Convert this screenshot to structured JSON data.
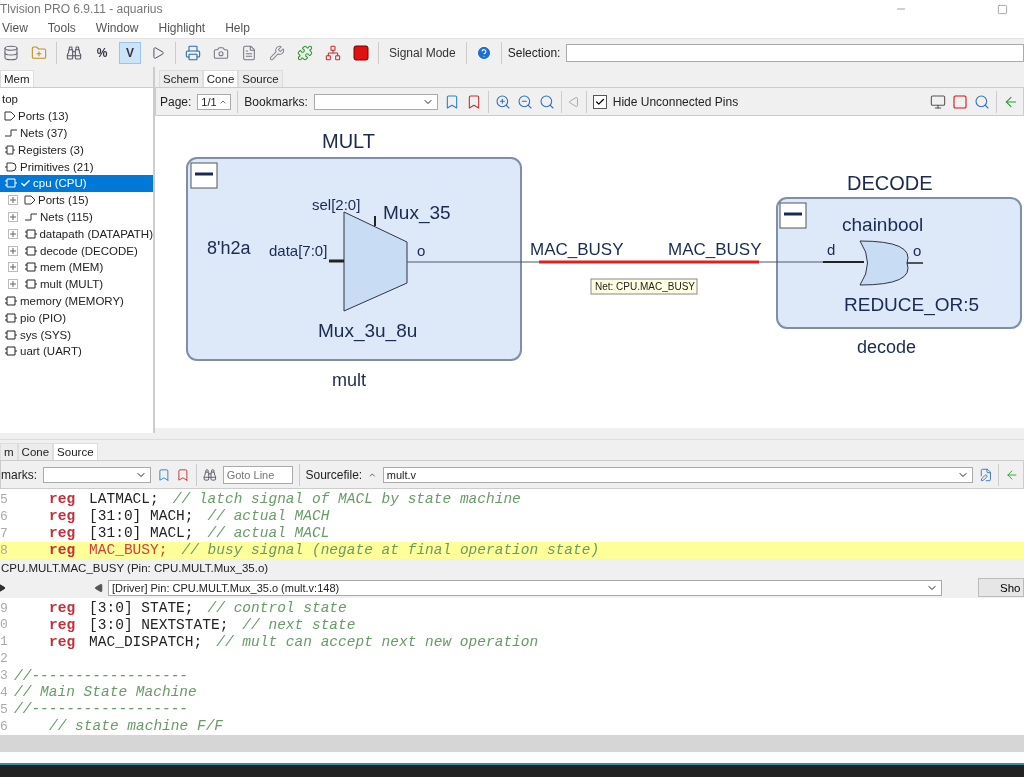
{
  "window": {
    "title": "Tlvision PRO 6.9.11 - aquarius"
  },
  "menu": [
    "View",
    "Tools",
    "Window",
    "Highlight",
    "Help"
  ],
  "toolbar": {
    "toggles": [
      {
        "label": "%",
        "selected": false
      },
      {
        "label": "V",
        "selected": true
      }
    ],
    "signal_mode": "Signal Mode",
    "selection_label": "Selection:"
  },
  "left_panel": {
    "tab": "Mem",
    "tree": {
      "label": "top",
      "selected": false,
      "children": [
        {
          "label": "Ports (13)",
          "kind": "port",
          "selected": false
        },
        {
          "label": "Nets (37)",
          "kind": "net",
          "selected": false
        },
        {
          "label": "Registers (3)",
          "kind": "register",
          "selected": false
        },
        {
          "label": "Primitives (21)",
          "kind": "primitive",
          "selected": false
        },
        {
          "label": "cpu (CPU)",
          "kind": "instance",
          "selected": true,
          "children": [
            {
              "label": "Ports (15)",
              "kind": "port",
              "selected": false,
              "expanded": false
            },
            {
              "label": "Nets (115)",
              "kind": "net",
              "selected": false,
              "expanded": false
            },
            {
              "label": "datapath (DATAPATH)",
              "kind": "instance",
              "selected": false,
              "expanded": false
            },
            {
              "label": "decode (DECODE)",
              "kind": "instance",
              "selected": false,
              "expanded": false
            },
            {
              "label": "mem (MEM)",
              "kind": "instance",
              "selected": false,
              "expanded": false
            },
            {
              "label": "mult (MULT)",
              "kind": "instance",
              "selected": false,
              "expanded": false
            }
          ]
        },
        {
          "label": "memory (MEMORY)",
          "kind": "instance",
          "selected": false
        },
        {
          "label": "pio (PIO)",
          "kind": "instance",
          "selected": false
        },
        {
          "label": "sys (SYS)",
          "kind": "instance",
          "selected": false
        },
        {
          "label": "uart (UART)",
          "kind": "instance",
          "selected": false
        }
      ]
    }
  },
  "schematic_tabs": [
    {
      "label": "Schem",
      "selected": false
    },
    {
      "label": "Cone",
      "selected": true
    },
    {
      "label": "Source",
      "selected": false
    }
  ],
  "schematic_toolbar": {
    "page_label": "Page:",
    "page": "1/1",
    "bookmarks_label": "Bookmarks:",
    "hide_pins": {
      "label": "Hide Unconnected Pins",
      "checked": true
    }
  },
  "schematic": {
    "mult_block": {
      "title": "MULT",
      "instance": "mult",
      "expanded": true,
      "constant": "8'h2a",
      "mux": {
        "name": "Mux_35",
        "cell": "Mux_3u_8u",
        "select_pin": "sel[2:0]",
        "data_pin": "data[7:0]",
        "output_pin": "o"
      }
    },
    "net": {
      "labels": [
        "MAC_BUSY",
        "MAC_BUSY"
      ],
      "highlighted": true,
      "tooltip": "Net: CPU.MAC_BUSY"
    },
    "decode_block": {
      "title": "DECODE",
      "instance": "decode",
      "expanded": true,
      "gate": {
        "name": "chainbool",
        "cell": "REDUCE_OR:5",
        "input_pin": "d",
        "output_pin": "o"
      }
    }
  },
  "source_tabs": [
    {
      "label": "m",
      "selected": false
    },
    {
      "label": "Cone",
      "selected": false
    },
    {
      "label": "Source",
      "selected": true
    }
  ],
  "source_toolbar": {
    "bookmarks_label": "marks:",
    "goto_placeholder": "Goto Line",
    "sourcefile_label": "Sourcefile:",
    "sourcefile": "mult.v"
  },
  "code_top": [
    {
      "number": "5",
      "indented": true,
      "keyword": "reg",
      "code": "LATMACL;",
      "comment": "// latch signal of MACL by state machine",
      "highlighted": false
    },
    {
      "number": "6",
      "indented": true,
      "keyword": "reg",
      "code": "[31:0] MACH;",
      "comment": "// actual MACH",
      "highlighted": false
    },
    {
      "number": "7",
      "indented": true,
      "keyword": "reg",
      "code": "[31:0] MACL;",
      "comment": "// actual MACL",
      "highlighted": false
    },
    {
      "number": "8",
      "indented": true,
      "keyword": "reg",
      "code": "MAC_BUSY;",
      "comment": "// busy signal (negate at final operation state)",
      "highlighted": true
    }
  ],
  "status": "CPU.MULT.MAC_BUSY (Pin:  CPU.MULT.Mux_35.o)",
  "driver": {
    "value": "[Driver] Pin:  CPU.MULT.Mux_35.o (mult.v:148)",
    "button": "Sho"
  },
  "code_bottom": [
    {
      "number": "9",
      "indented": true,
      "keyword": "reg",
      "code": "[3:0] STATE;",
      "comment": "// control state",
      "highlighted": false
    },
    {
      "number": "0",
      "indented": true,
      "keyword": "reg",
      "code": "[3:0] NEXTSTATE;",
      "comment": "// next state",
      "highlighted": false
    },
    {
      "number": "1",
      "indented": true,
      "keyword": "reg",
      "code": "MAC_DISPATCH;",
      "comment": "// mult can accept next new operation",
      "highlighted": false
    },
    {
      "number": "2",
      "indented": false,
      "highlighted": false
    },
    {
      "number": "3",
      "indented": false,
      "comment": "//------------------",
      "highlighted": false
    },
    {
      "number": "4",
      "indented": false,
      "comment": "// Main State Machine",
      "highlighted": false
    },
    {
      "number": "5",
      "indented": false,
      "comment": "//------------------",
      "highlighted": false
    },
    {
      "number": "6",
      "indented": true,
      "comment": "// state machine F/F",
      "highlighted": false
    }
  ]
}
